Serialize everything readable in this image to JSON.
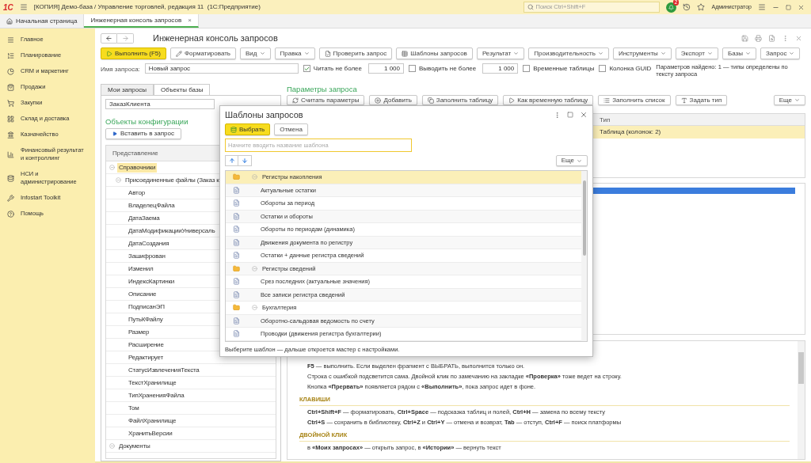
{
  "app_bar": {
    "logo": "1С",
    "title": "[КОПИЯ] Демо-база / Управление торговлей, редакция 11  (1С:Предприятие)",
    "search_placeholder": "Поиск Ctrl+Shift+F",
    "notifications": "2",
    "user": "Администратор"
  },
  "open_tabs": [
    {
      "label": "Начальная страница",
      "selected": false
    },
    {
      "label": "Инженерная консоль запросов",
      "selected": true,
      "close": "×"
    }
  ],
  "sidebar": {
    "items": [
      {
        "label": "Главное"
      },
      {
        "label": "Планирование"
      },
      {
        "label": "CRM и маркетинг"
      },
      {
        "label": "Продажи"
      },
      {
        "label": "Закупки"
      },
      {
        "label": "Склад и доставка"
      },
      {
        "label": "Казначейство"
      },
      {
        "label": "Финансовый результат и контроллинг"
      },
      {
        "label": "НСИ и администрирование"
      },
      {
        "label": "Infostart Toolkit"
      },
      {
        "label": "Помощь"
      }
    ]
  },
  "form": {
    "title": "Инженерная консоль запросов",
    "toolbar": [
      {
        "label": "Выполнить (F5)",
        "kind": "primary"
      },
      {
        "label": "Форматировать",
        "kind": "plain"
      },
      {
        "label": "Вид",
        "kind": "menu"
      },
      {
        "label": "Правка",
        "kind": "menu"
      },
      {
        "label": "Проверить запрос",
        "kind": "plain"
      },
      {
        "label": "Шаблоны запросов",
        "kind": "plain"
      },
      {
        "label": "Результат",
        "kind": "menu"
      },
      {
        "label": "Производительность",
        "kind": "menu"
      },
      {
        "label": "Инструменты",
        "kind": "menu"
      },
      {
        "label": "Экспорт",
        "kind": "menu"
      },
      {
        "label": "Базы",
        "kind": "menu"
      },
      {
        "label": "Запрос",
        "kind": "menu"
      }
    ],
    "query_name": {
      "label": "Имя запроса:",
      "value": "Новый запрос"
    },
    "options": [
      {
        "label": "Читать не более",
        "checked": true,
        "value": "1 000"
      },
      {
        "label": "Выводить не более",
        "checked": false,
        "value": "1 000"
      },
      {
        "label": "Временные таблицы",
        "checked": false
      },
      {
        "label": "Колонка GUID",
        "checked": false
      }
    ],
    "params_info": "Параметров найдено: 1 — типы определены по тексту запроса"
  },
  "left_panel": {
    "tabs": [
      {
        "label": "Мои запросы",
        "selected": false
      },
      {
        "label": "Объекты базы",
        "selected": true
      }
    ],
    "search_value": "ЗаказКлиента",
    "heading": "Объекты конфигурации",
    "insert_button": "Вставить в запрос",
    "column": "Представление",
    "tree": [
      {
        "label": "Справочники",
        "selected": true,
        "expanded": true,
        "children": [
          {
            "label": "Присоединенные файлы (Заказ к",
            "selected": false,
            "expanded": true,
            "children": [
              {
                "label": "Автор",
                "selected": false
              },
              {
                "label": "ВладелецФайла",
                "selected": false
              },
              {
                "label": "ДатаЗаема",
                "selected": false
              },
              {
                "label": "ДатаМодификацииУниверсаль",
                "selected": false
              },
              {
                "label": "ДатаСоздания",
                "selected": false
              },
              {
                "label": "Зашифрован",
                "selected": false
              },
              {
                "label": "Изменил",
                "selected": false
              },
              {
                "label": "ИндексКартинки",
                "selected": false
              },
              {
                "label": "Описание",
                "selected": false
              },
              {
                "label": "ПодписанЭП",
                "selected": false
              },
              {
                "label": "ПутьКФайлу",
                "selected": false
              },
              {
                "label": "Размер",
                "selected": false
              },
              {
                "label": "Расширение",
                "selected": false
              },
              {
                "label": "Редактирует",
                "selected": false
              },
              {
                "label": "СтатусИзвлеченияТекста",
                "selected": false
              },
              {
                "label": "ТекстХранилище",
                "selected": false
              },
              {
                "label": "ТипХраненияФайла",
                "selected": false
              },
              {
                "label": "Том",
                "selected": false
              },
              {
                "label": "ФайлХранилище",
                "selected": false
              },
              {
                "label": "ХранитьВерсии",
                "selected": false
              }
            ]
          }
        ]
      },
      {
        "label": "Документы",
        "selected": false,
        "expanded": true
      }
    ]
  },
  "params": {
    "heading": "Параметры запроса",
    "buttons": [
      {
        "label": "Считать параметры",
        "kind": "plain"
      },
      {
        "label": "Добавить",
        "kind": "plain"
      },
      {
        "label": "Заполнить таблицу",
        "kind": "plain"
      },
      {
        "label": "Как временную таблицу",
        "kind": "plain"
      },
      {
        "label": "Заполнить список",
        "kind": "plain"
      },
      {
        "label": "Задать тип",
        "kind": "plain"
      },
      {
        "label": "Еще",
        "kind": "menu"
      }
    ],
    "column": "Тип",
    "rows": [
      {
        "type": "Таблица (колонок: 2)",
        "selected": true
      }
    ]
  },
  "help": [
    {
      "kind": "text",
      "text": "**F5** — выполнить. Если выделен фрагмент с ВЫБРАТЬ, выполнится только он."
    },
    {
      "kind": "text",
      "text": "Строка с ошибкой подсветится сама. Двойной клик по замечанию на закладке **«Проверка»** тоже ведет на строку."
    },
    {
      "kind": "text",
      "text": "Кнопка **«Прервать»** появляется рядом с **«Выполнить»**, пока запрос идет в фоне."
    },
    {
      "kind": "heading",
      "text": "КЛАВИШИ"
    },
    {
      "kind": "text",
      "text": "**Ctrl+Shift+F** — форматировать, **Ctrl+Space** — подсказка таблиц и полей, **Ctrl+H** — замена по всему тексту"
    },
    {
      "kind": "text",
      "text": "**Ctrl+S** — сохранить в библиотеку, **Ctrl+Z** и **Ctrl+Y** — отмена и возврат, **Tab** — отступ, **Ctrl+F** — поиск платформы"
    },
    {
      "kind": "heading",
      "text": "ДВОЙНОЙ КЛИК"
    },
    {
      "kind": "text",
      "text": "в **«Моих запросах»** — открыть запрос, в **«Истории»** — вернуть текст"
    }
  ],
  "dialog": {
    "title": "Шаблоны запросов",
    "buttons": [
      {
        "label": "Выбрать",
        "kind": "primary"
      },
      {
        "label": "Отмена",
        "kind": "plain"
      }
    ],
    "search_placeholder": "Начните вводить название шаблона",
    "more_button": "Еще",
    "items": [
      {
        "label": "Регистры накопления",
        "selected": true,
        "expanded": true,
        "children": [
          {
            "label": "Актуальные остатки",
            "selected": false
          },
          {
            "label": "Обороты за период",
            "selected": false
          },
          {
            "label": "Остатки и обороты",
            "selected": false
          },
          {
            "label": "Обороты по периодам (динамика)",
            "selected": false
          },
          {
            "label": "Движения документа по регистру",
            "selected": false
          },
          {
            "label": "Остатки + данные регистра сведений",
            "selected": false
          }
        ]
      },
      {
        "label": "Регистры сведений",
        "selected": false,
        "expanded": true,
        "children": [
          {
            "label": "Срез последних (актуальные значения)",
            "selected": false
          },
          {
            "label": "Все записи регистра сведений",
            "selected": false
          }
        ]
      },
      {
        "label": "Бухгалтерия",
        "selected": false,
        "expanded": true,
        "children": [
          {
            "label": "Оборотно-сальдовая ведомость по счету",
            "selected": false
          },
          {
            "label": "Проводки (движения регистра бухгалтерии)",
            "selected": false
          }
        ]
      }
    ],
    "footer": "Выберите шаблон — дальше откроется мастер с настройками."
  }
}
